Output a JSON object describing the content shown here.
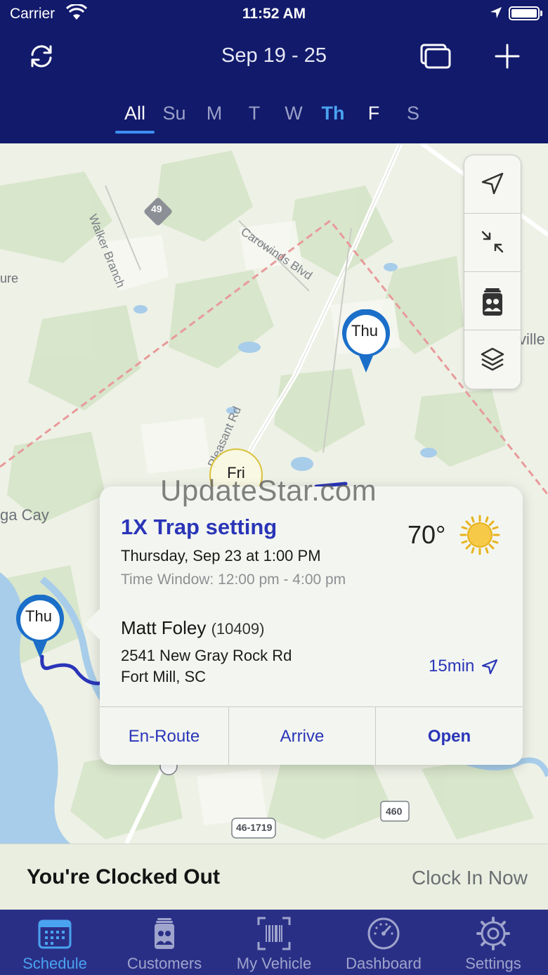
{
  "status_bar": {
    "carrier": "Carrier",
    "time": "11:52 AM"
  },
  "nav": {
    "title": "Sep 19 - 25"
  },
  "day_tabs": [
    {
      "label": "All",
      "state": "selected"
    },
    {
      "label": "Su",
      "state": "normal"
    },
    {
      "label": "M",
      "state": "normal"
    },
    {
      "label": "T",
      "state": "normal"
    },
    {
      "label": "W",
      "state": "normal"
    },
    {
      "label": "Th",
      "state": "today"
    },
    {
      "label": "F",
      "state": "bright"
    },
    {
      "label": "S",
      "state": "normal"
    }
  ],
  "map": {
    "road_labels": {
      "walker_branch": "Walker Branch",
      "carowinds": "Carowinds Blvd",
      "pleasant": "Pleasant Rd",
      "route_49": "49",
      "route_460": "460",
      "route_46": "46-1719"
    },
    "side_labels": {
      "left_top": "ure",
      "left_mid": "ga Cay",
      "right": "ville"
    },
    "pins": {
      "pin_top": "Thu",
      "pin_left": "Thu",
      "fri_marker": "Fri"
    },
    "watermark": "UpdateStar.com"
  },
  "popup": {
    "service": "1X Trap setting",
    "date": "Thursday, Sep 23 at 1:00 PM",
    "time_window": "Time Window:  12:00 pm - 4:00 pm",
    "temperature": "70°",
    "customer_name": "Matt Foley",
    "customer_id": "(10409)",
    "address_line1": "2541 New Gray Rock Rd",
    "address_line2": "Fort Mill, SC",
    "eta": "15min",
    "actions": {
      "enroute": "En-Route",
      "arrive": "Arrive",
      "open": "Open"
    }
  },
  "clock": {
    "status": "You're Clocked Out",
    "action": "Clock In Now"
  },
  "tab_bar": [
    {
      "label": "Schedule",
      "icon": "calendar-icon",
      "active": true
    },
    {
      "label": "Customers",
      "icon": "customers-icon",
      "active": false
    },
    {
      "label": "My Vehicle",
      "icon": "barcode-icon",
      "active": false
    },
    {
      "label": "Dashboard",
      "icon": "gauge-icon",
      "active": false
    },
    {
      "label": "Settings",
      "icon": "gear-icon",
      "active": false
    }
  ],
  "colors": {
    "header": "#121a6b",
    "accent": "#2a35b8",
    "highlight": "#4aa3f0",
    "tab_bar": "#2a2f86"
  }
}
